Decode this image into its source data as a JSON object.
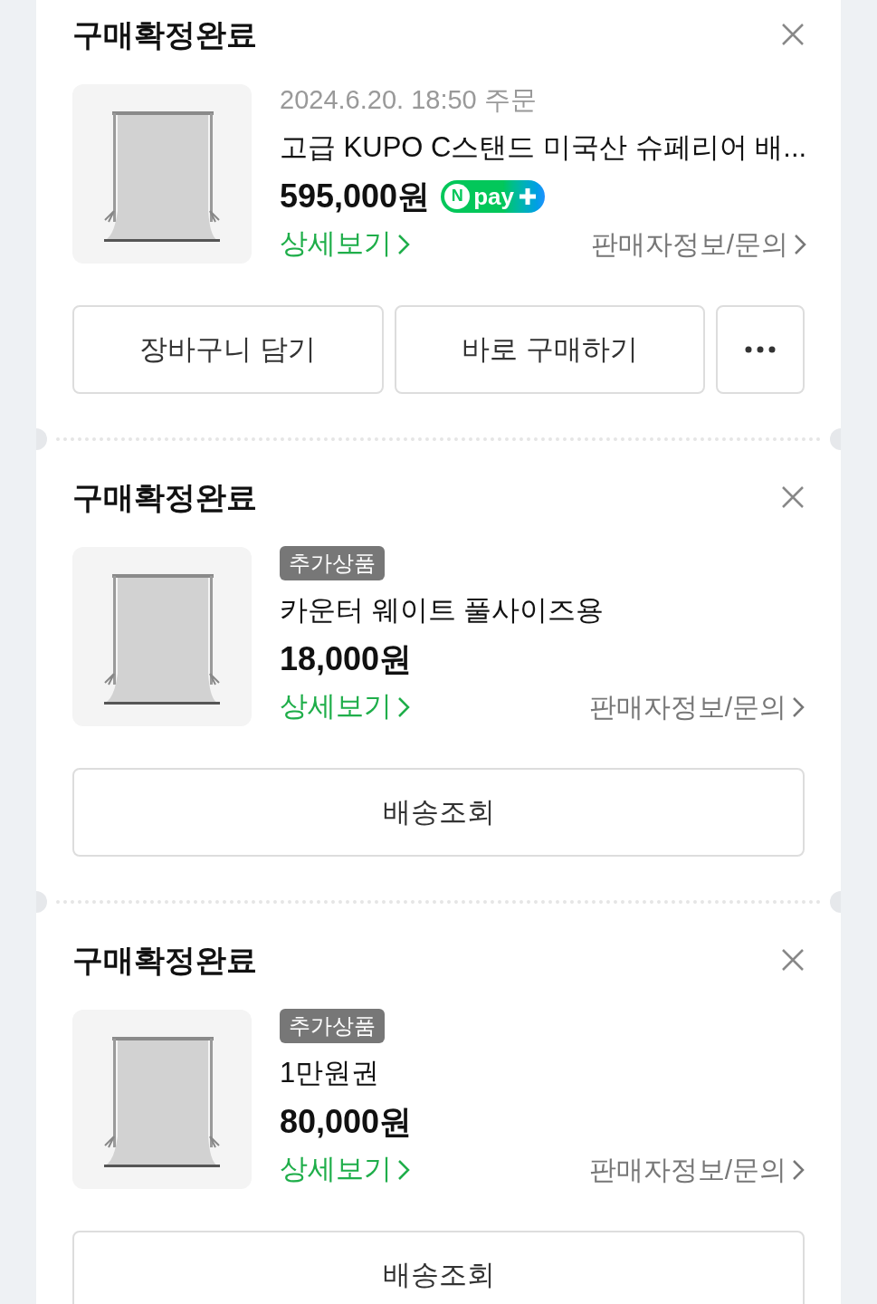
{
  "orders": [
    {
      "status": "구매확정완료",
      "date": "2024.6.20. 18:50 주문",
      "name": "고급 KUPO C스탠드 미국산 슈페리어 배...",
      "price": "595,000원",
      "badge": {
        "mark": "N",
        "label": "pay"
      },
      "detail_link": "상세보기",
      "seller_link": "판매자정보/문의",
      "buttons": [
        {
          "kind": "text",
          "label": "장바구니 담기"
        },
        {
          "kind": "text",
          "label": "바로 구매하기"
        },
        {
          "kind": "more"
        }
      ]
    },
    {
      "status": "구매확정완료",
      "tag": "추가상품",
      "name": "카운터 웨이트 풀사이즈용",
      "price": "18,000원",
      "detail_link": "상세보기",
      "seller_link": "판매자정보/문의",
      "buttons": [
        {
          "kind": "text",
          "label": "배송조회"
        }
      ]
    },
    {
      "status": "구매확정완료",
      "tag": "추가상품",
      "name": "1만원권",
      "price": "80,000원",
      "detail_link": "상세보기",
      "seller_link": "판매자정보/문의",
      "buttons": [
        {
          "kind": "text",
          "label": "배송조회"
        }
      ]
    }
  ]
}
